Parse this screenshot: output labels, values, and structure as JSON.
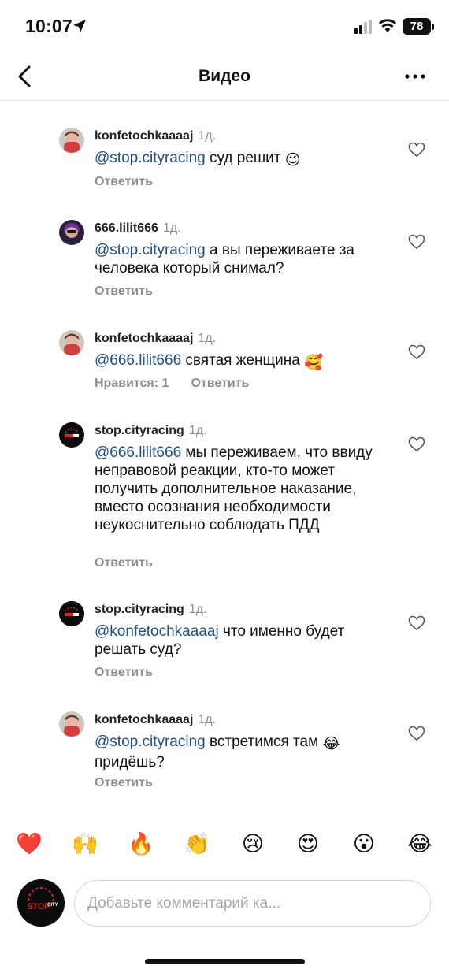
{
  "status_bar": {
    "time": "10:07",
    "battery": "78"
  },
  "nav": {
    "title": "Видео",
    "back_icon": "chevron-left-icon",
    "more_icon": "more-horizontal-icon"
  },
  "comments": [
    {
      "username": "konfetochkaaaaj",
      "time": "1д.",
      "mention": "@stop.cityracing",
      "text": " суд решит ",
      "emoji": "😉",
      "likes": "",
      "reply": "Ответить"
    },
    {
      "username": "666.lilit666",
      "time": "1д.",
      "mention": "@stop.cityracing",
      "text": " а вы переживаете за человека который снимал?",
      "emoji": "",
      "likes": "",
      "reply": "Ответить"
    },
    {
      "username": "konfetochkaaaaj",
      "time": "1д.",
      "mention": "@666.lilit666",
      "text": " святая женщина ",
      "emoji": "🥰",
      "likes": "Нравится: 1",
      "reply": "Ответить"
    },
    {
      "username": "stop.cityracing",
      "time": "1д.",
      "mention": "@666.lilit666",
      "text": " мы переживаем, что ввиду неправовой реакции, кто-то может получить дополнительное наказание, вместо осознания необходимости неукоснительно соблюдать ПДД",
      "emoji": "",
      "likes": "",
      "reply": "Ответить"
    },
    {
      "username": "stop.cityracing",
      "time": "1д.",
      "mention": "@konfetochkaaaaj",
      "text": " что именно будет решать суд?",
      "emoji": "",
      "likes": "",
      "reply": "Ответить"
    },
    {
      "username": "konfetochkaaaaj",
      "time": "1д.",
      "mention": "@stop.cityracing",
      "text": " встретимся там ",
      "emoji": "😂",
      "text_after": " придёшь?",
      "likes": "",
      "reply": "Ответить"
    }
  ],
  "reactions": [
    "❤️",
    "🙌",
    "🔥",
    "👏",
    "😢",
    "😍",
    "😮",
    "😂"
  ],
  "composer": {
    "placeholder": "Добавьте комментарий ка..."
  },
  "brand": {
    "logo_text_stop": "STOP",
    "logo_text_city": "CITY",
    "accent": "#e0251b"
  },
  "colors": {
    "mention": "#1f4f86",
    "meta": "#8e8e8e"
  }
}
